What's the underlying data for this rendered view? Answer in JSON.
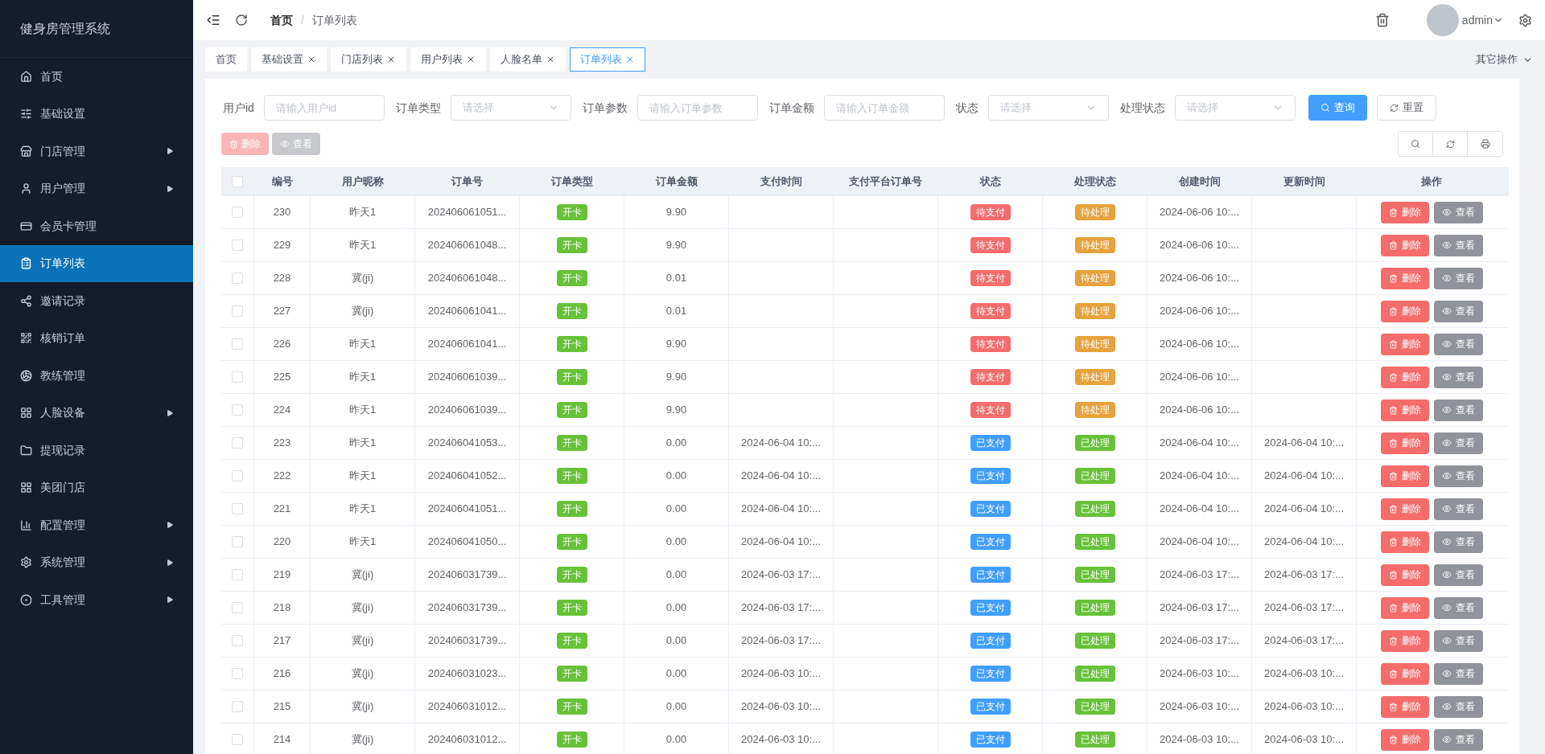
{
  "app_title": "健身房管理系统",
  "sidebar": {
    "items": [
      {
        "label": "首页",
        "kind": "link",
        "selected": false
      },
      {
        "label": "基础设置",
        "kind": "link",
        "selected": false
      },
      {
        "label": "门店管理",
        "kind": "group",
        "selected": false
      },
      {
        "label": "用户管理",
        "kind": "group",
        "selected": false
      },
      {
        "label": "会员卡管理",
        "kind": "link",
        "selected": false
      },
      {
        "label": "订单列表",
        "kind": "link",
        "selected": true
      },
      {
        "label": "邀请记录",
        "kind": "link",
        "selected": false
      },
      {
        "label": "核销订单",
        "kind": "link",
        "selected": false
      },
      {
        "label": "教练管理",
        "kind": "link",
        "selected": false
      },
      {
        "label": "人脸设备",
        "kind": "group",
        "selected": false
      },
      {
        "label": "提现记录",
        "kind": "link",
        "selected": false
      },
      {
        "label": "美团门店",
        "kind": "link",
        "selected": false
      },
      {
        "label": "配置管理",
        "kind": "group",
        "selected": false
      },
      {
        "label": "系统管理",
        "kind": "group",
        "selected": false
      },
      {
        "label": "工具管理",
        "kind": "group",
        "selected": false
      }
    ]
  },
  "breadcrumb": [
    "首页",
    "订单列表"
  ],
  "breadcrumb_separator": "/",
  "user": {
    "name": "admin"
  },
  "tabs": [
    {
      "label": "首页",
      "closable": false,
      "selected": false
    },
    {
      "label": "基础设置",
      "closable": true,
      "selected": false
    },
    {
      "label": "门店列表",
      "closable": true,
      "selected": false
    },
    {
      "label": "用户列表",
      "closable": true,
      "selected": false
    },
    {
      "label": "人脸名单",
      "closable": true,
      "selected": false
    },
    {
      "label": "订单列表",
      "closable": true,
      "selected": true
    }
  ],
  "other_actions": "其它操作",
  "filters": [
    {
      "label": "用户id",
      "kind": "input",
      "placeholder": "请输入用户id"
    },
    {
      "label": "订单类型",
      "kind": "select",
      "placeholder": "请选择"
    },
    {
      "label": "订单参数",
      "kind": "input",
      "placeholder": "请输入订单参数"
    },
    {
      "label": "订单金额",
      "kind": "input",
      "placeholder": "请输入订单金额"
    },
    {
      "label": "状态",
      "kind": "select",
      "placeholder": "请选择"
    },
    {
      "label": "处理状态",
      "kind": "select",
      "placeholder": "请选择"
    }
  ],
  "search_button": "查询",
  "reset_button": "重置",
  "bulk_buttons": [
    {
      "label": "删除",
      "kind": "delete",
      "disabled": true
    },
    {
      "label": "查看",
      "kind": "view",
      "disabled": true
    }
  ],
  "table": {
    "select_all_checked": false,
    "columns": [
      "编号",
      "用户昵称",
      "订单号",
      "订单类型",
      "订单金额",
      "支付时间",
      "支付平台订单号",
      "状态",
      "处理状态",
      "创建时间",
      "更新时间",
      "操作"
    ],
    "rows": [
      {
        "checked": false,
        "id": "230",
        "nickname": "昨天1",
        "order_no": "202406061051...",
        "type": {
          "text": "开卡",
          "color": "#67c23a"
        },
        "amount": "9.90",
        "pay_time": "",
        "status": {
          "text": "待支付",
          "color": "#f56c6c"
        },
        "process": {
          "text": "待处理",
          "color": "#e6a23c"
        },
        "created": "2024-06-06 10:...",
        "updated": "",
        "actions": [
          "删除",
          "查看"
        ]
      },
      {
        "checked": false,
        "id": "229",
        "nickname": "昨天1",
        "order_no": "202406061048...",
        "type": {
          "text": "开卡",
          "color": "#67c23a"
        },
        "amount": "9.90",
        "pay_time": "",
        "status": {
          "text": "待支付",
          "color": "#f56c6c"
        },
        "process": {
          "text": "待处理",
          "color": "#e6a23c"
        },
        "created": "2024-06-06 10:...",
        "updated": "",
        "actions": [
          "删除",
          "查看"
        ]
      },
      {
        "checked": false,
        "id": "228",
        "nickname": "冀(ji)",
        "order_no": "202406061048...",
        "type": {
          "text": "开卡",
          "color": "#67c23a"
        },
        "amount": "0.01",
        "pay_time": "",
        "status": {
          "text": "待支付",
          "color": "#f56c6c"
        },
        "process": {
          "text": "待处理",
          "color": "#e6a23c"
        },
        "created": "2024-06-06 10:...",
        "updated": "",
        "actions": [
          "删除",
          "查看"
        ]
      },
      {
        "checked": false,
        "id": "227",
        "nickname": "冀(ji)",
        "order_no": "202406061041...",
        "type": {
          "text": "开卡",
          "color": "#67c23a"
        },
        "amount": "0.01",
        "pay_time": "",
        "status": {
          "text": "待支付",
          "color": "#f56c6c"
        },
        "process": {
          "text": "待处理",
          "color": "#e6a23c"
        },
        "created": "2024-06-06 10:...",
        "updated": "",
        "actions": [
          "删除",
          "查看"
        ]
      },
      {
        "checked": false,
        "id": "226",
        "nickname": "昨天1",
        "order_no": "202406061041...",
        "type": {
          "text": "开卡",
          "color": "#67c23a"
        },
        "amount": "9.90",
        "pay_time": "",
        "status": {
          "text": "待支付",
          "color": "#f56c6c"
        },
        "process": {
          "text": "待处理",
          "color": "#e6a23c"
        },
        "created": "2024-06-06 10:...",
        "updated": "",
        "actions": [
          "删除",
          "查看"
        ]
      },
      {
        "checked": false,
        "id": "225",
        "nickname": "昨天1",
        "order_no": "202406061039...",
        "type": {
          "text": "开卡",
          "color": "#67c23a"
        },
        "amount": "9.90",
        "pay_time": "",
        "status": {
          "text": "待支付",
          "color": "#f56c6c"
        },
        "process": {
          "text": "待处理",
          "color": "#e6a23c"
        },
        "created": "2024-06-06 10:...",
        "updated": "",
        "actions": [
          "删除",
          "查看"
        ]
      },
      {
        "checked": false,
        "id": "224",
        "nickname": "昨天1",
        "order_no": "202406061039...",
        "type": {
          "text": "开卡",
          "color": "#67c23a"
        },
        "amount": "9.90",
        "pay_time": "",
        "status": {
          "text": "待支付",
          "color": "#f56c6c"
        },
        "process": {
          "text": "待处理",
          "color": "#e6a23c"
        },
        "created": "2024-06-06 10:...",
        "updated": "",
        "actions": [
          "删除",
          "查看"
        ]
      },
      {
        "checked": false,
        "id": "223",
        "nickname": "昨天1",
        "order_no": "202406041053...",
        "type": {
          "text": "开卡",
          "color": "#67c23a"
        },
        "amount": "0.00",
        "pay_time": "2024-06-04 10:...",
        "status": {
          "text": "已支付",
          "color": "#409eff"
        },
        "process": {
          "text": "已处理",
          "color": "#67c23a"
        },
        "created": "2024-06-04 10:...",
        "updated": "2024-06-04 10:...",
        "actions": [
          "删除",
          "查看"
        ]
      },
      {
        "checked": false,
        "id": "222",
        "nickname": "昨天1",
        "order_no": "202406041052...",
        "type": {
          "text": "开卡",
          "color": "#67c23a"
        },
        "amount": "0.00",
        "pay_time": "2024-06-04 10:...",
        "status": {
          "text": "已支付",
          "color": "#409eff"
        },
        "process": {
          "text": "已处理",
          "color": "#67c23a"
        },
        "created": "2024-06-04 10:...",
        "updated": "2024-06-04 10:...",
        "actions": [
          "删除",
          "查看"
        ]
      },
      {
        "checked": false,
        "id": "221",
        "nickname": "昨天1",
        "order_no": "202406041051...",
        "type": {
          "text": "开卡",
          "color": "#67c23a"
        },
        "amount": "0.00",
        "pay_time": "2024-06-04 10:...",
        "status": {
          "text": "已支付",
          "color": "#409eff"
        },
        "process": {
          "text": "已处理",
          "color": "#67c23a"
        },
        "created": "2024-06-04 10:...",
        "updated": "2024-06-04 10:...",
        "actions": [
          "删除",
          "查看"
        ]
      },
      {
        "checked": false,
        "id": "220",
        "nickname": "昨天1",
        "order_no": "202406041050...",
        "type": {
          "text": "开卡",
          "color": "#67c23a"
        },
        "amount": "0.00",
        "pay_time": "2024-06-04 10:...",
        "status": {
          "text": "已支付",
          "color": "#409eff"
        },
        "process": {
          "text": "已处理",
          "color": "#67c23a"
        },
        "created": "2024-06-04 10:...",
        "updated": "2024-06-04 10:...",
        "actions": [
          "删除",
          "查看"
        ]
      },
      {
        "checked": false,
        "id": "219",
        "nickname": "冀(ji)",
        "order_no": "202406031739...",
        "type": {
          "text": "开卡",
          "color": "#67c23a"
        },
        "amount": "0.00",
        "pay_time": "2024-06-03 17:...",
        "status": {
          "text": "已支付",
          "color": "#409eff"
        },
        "process": {
          "text": "已处理",
          "color": "#67c23a"
        },
        "created": "2024-06-03 17:...",
        "updated": "2024-06-03 17:...",
        "actions": [
          "删除",
          "查看"
        ]
      },
      {
        "checked": false,
        "id": "218",
        "nickname": "冀(ji)",
        "order_no": "202406031739...",
        "type": {
          "text": "开卡",
          "color": "#67c23a"
        },
        "amount": "0.00",
        "pay_time": "2024-06-03 17:...",
        "status": {
          "text": "已支付",
          "color": "#409eff"
        },
        "process": {
          "text": "已处理",
          "color": "#67c23a"
        },
        "created": "2024-06-03 17:...",
        "updated": "2024-06-03 17:...",
        "actions": [
          "删除",
          "查看"
        ]
      },
      {
        "checked": false,
        "id": "217",
        "nickname": "冀(ji)",
        "order_no": "202406031739...",
        "type": {
          "text": "开卡",
          "color": "#67c23a"
        },
        "amount": "0.00",
        "pay_time": "2024-06-03 17:...",
        "status": {
          "text": "已支付",
          "color": "#409eff"
        },
        "process": {
          "text": "已处理",
          "color": "#67c23a"
        },
        "created": "2024-06-03 17:...",
        "updated": "2024-06-03 17:...",
        "actions": [
          "删除",
          "查看"
        ]
      },
      {
        "checked": false,
        "id": "216",
        "nickname": "冀(ji)",
        "order_no": "202406031023...",
        "type": {
          "text": "开卡",
          "color": "#67c23a"
        },
        "amount": "0.00",
        "pay_time": "2024-06-03 10:...",
        "status": {
          "text": "已支付",
          "color": "#409eff"
        },
        "process": {
          "text": "已处理",
          "color": "#67c23a"
        },
        "created": "2024-06-03 10:...",
        "updated": "2024-06-03 10:...",
        "actions": [
          "删除",
          "查看"
        ]
      },
      {
        "checked": false,
        "id": "215",
        "nickname": "冀(ji)",
        "order_no": "202406031012...",
        "type": {
          "text": "开卡",
          "color": "#67c23a"
        },
        "amount": "0.00",
        "pay_time": "2024-06-03 10:...",
        "status": {
          "text": "已支付",
          "color": "#409eff"
        },
        "process": {
          "text": "已处理",
          "color": "#67c23a"
        },
        "created": "2024-06-03 10:...",
        "updated": "2024-06-03 10:...",
        "actions": [
          "删除",
          "查看"
        ]
      },
      {
        "checked": false,
        "id": "214",
        "nickname": "冀(ji)",
        "order_no": "202406031012...",
        "type": {
          "text": "开卡",
          "color": "#67c23a"
        },
        "amount": "0.00",
        "pay_time": "2024-06-03 10:...",
        "status": {
          "text": "已支付",
          "color": "#409eff"
        },
        "process": {
          "text": "已处理",
          "color": "#67c23a"
        },
        "created": "2024-06-03 10:...",
        "updated": "2024-06-03 10:...",
        "actions": [
          "删除",
          "查看"
        ]
      }
    ]
  }
}
